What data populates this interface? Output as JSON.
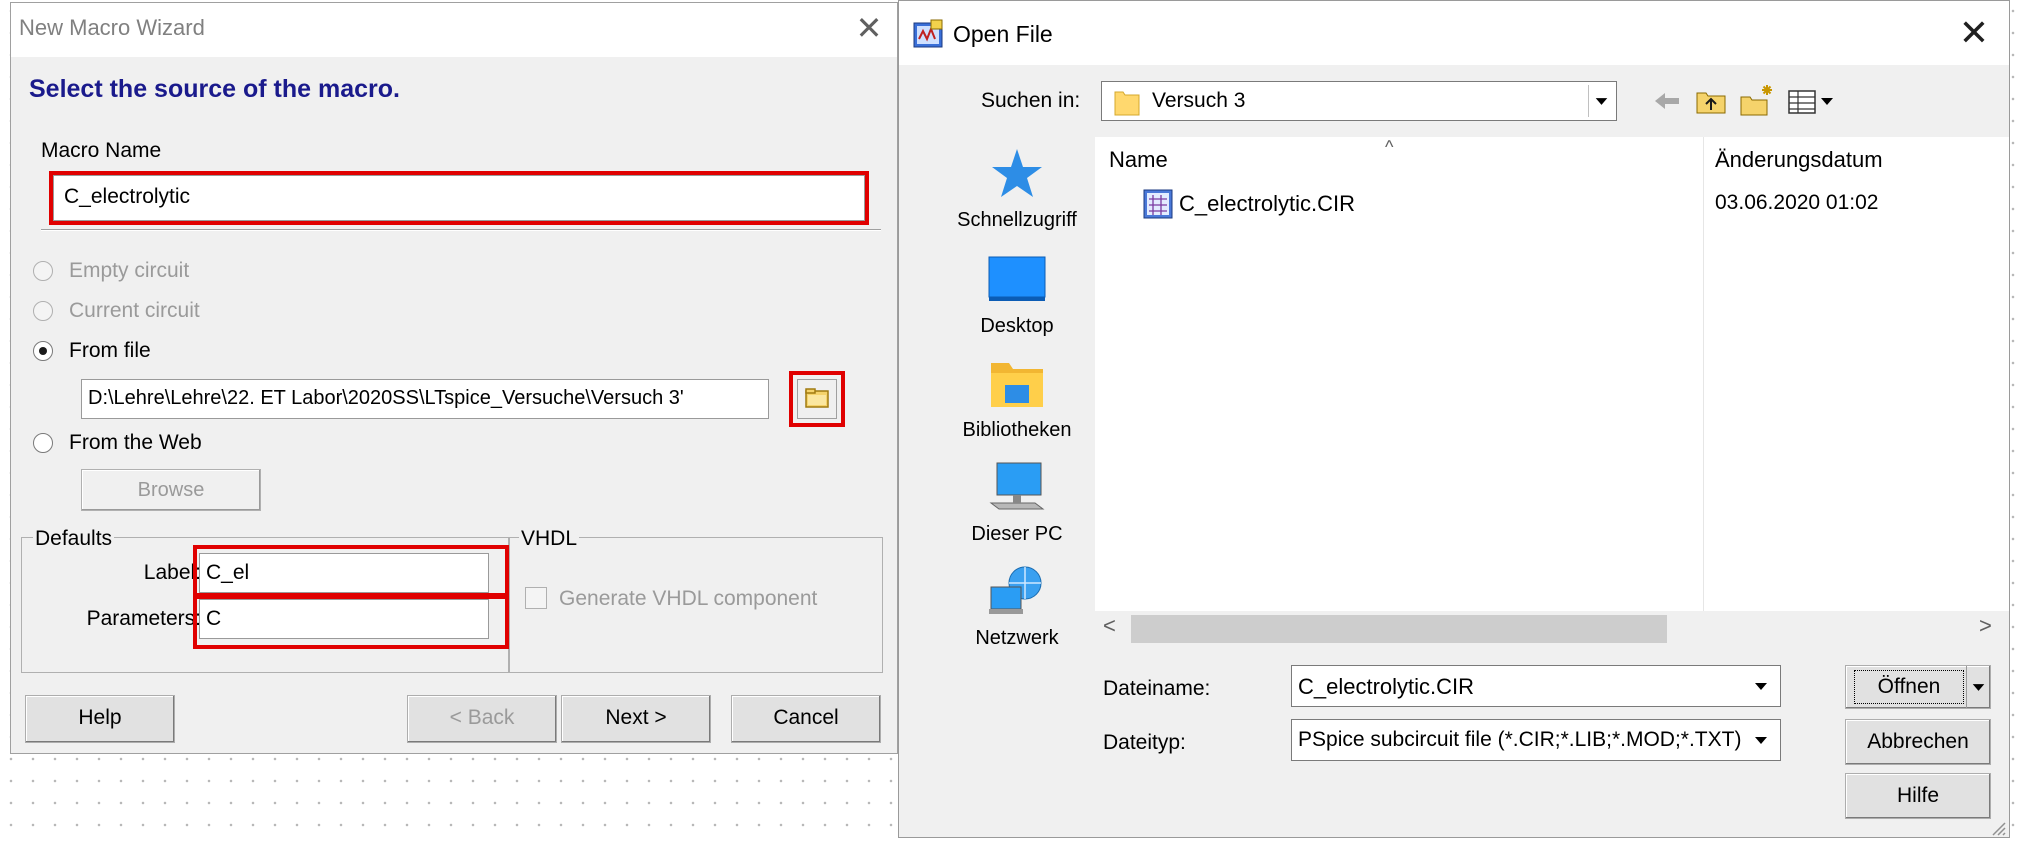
{
  "macro_wizard": {
    "title": "New Macro Wizard",
    "close_glyph": "✕",
    "heading": "Select the source of the macro.",
    "macro_name_label": "Macro Name",
    "macro_name_value": "C_electrolytic",
    "source_options": [
      {
        "label": "Empty circuit",
        "selected": false,
        "enabled": false
      },
      {
        "label": "Current circuit",
        "selected": false,
        "enabled": false
      },
      {
        "label": "From file",
        "selected": true,
        "enabled": true
      },
      {
        "label": "From the Web",
        "selected": false,
        "enabled": true
      }
    ],
    "file_path": "D:\\Lehre\\Lehre\\22. ET Labor\\2020SS\\LTspice_Versuche\\Versuch 3'",
    "browse_label": "Browse",
    "defaults": {
      "title": "Defaults",
      "label_label": "Label:",
      "label_value": "C_el",
      "parameters_label": "Parameters:",
      "parameters_value": "C"
    },
    "vhdl": {
      "title": "VHDL",
      "checkbox_label": "Generate VHDL component",
      "checked": false
    },
    "buttons": {
      "help": "Help",
      "back": "< Back",
      "next": "Next >",
      "cancel": "Cancel"
    },
    "highlight_color": "#e00000",
    "heading_color": "#1a1a8c"
  },
  "open_file": {
    "title": "Open File",
    "close_glyph": "✕",
    "look_in_label": "Suchen in:",
    "look_in_value": "Versuch 3",
    "places": [
      {
        "label": "Schnellzugriff",
        "icon": "star-icon"
      },
      {
        "label": "Desktop",
        "icon": "desktop-icon"
      },
      {
        "label": "Bibliotheken",
        "icon": "libraries-icon"
      },
      {
        "label": "Dieser PC",
        "icon": "computer-icon"
      },
      {
        "label": "Netzwerk",
        "icon": "network-icon"
      }
    ],
    "columns": {
      "name": "Name",
      "date": "Änderungsdatum"
    },
    "files": [
      {
        "name": "C_electrolytic.CIR",
        "date": "03.06.2020 01:02"
      }
    ],
    "filename_label": "Dateiname:",
    "filename_value": "C_electrolytic.CIR",
    "filetype_label": "Dateityp:",
    "filetype_value": "PSpice subcircuit file (*.CIR;*.LIB;*.MOD;*.TXT)",
    "buttons": {
      "open": "Öffnen",
      "cancel": "Abbrechen",
      "help": "Hilfe"
    }
  }
}
